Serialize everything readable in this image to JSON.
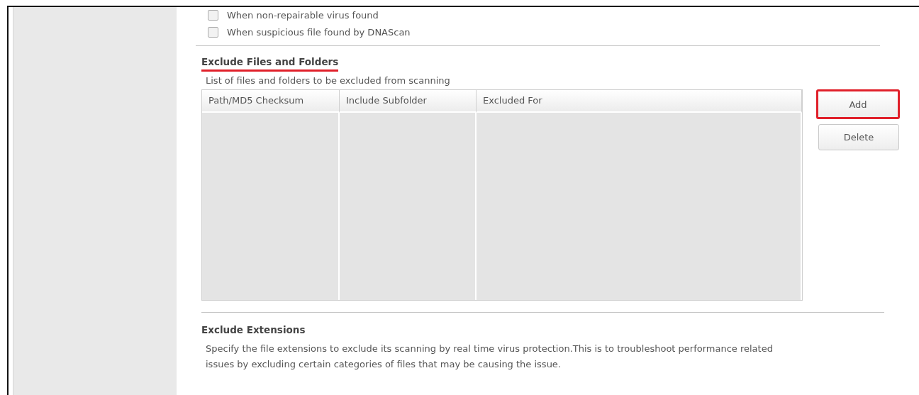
{
  "notifications": [
    {
      "label": "When non-repairable virus found",
      "checked": false
    },
    {
      "label": "When suspicious file found by DNAScan",
      "checked": false
    }
  ],
  "exclude_files": {
    "title": "Exclude Files and Folders",
    "highlighted": true,
    "description": "List of files and folders to be excluded from scanning",
    "table": {
      "columns": [
        "Path/MD5 Checksum",
        "Include Subfolder",
        "Excluded For"
      ]
    },
    "buttons": [
      {
        "label": "Add",
        "highlighted": true
      },
      {
        "label": "Delete",
        "highlighted": false
      }
    ]
  },
  "exclude_extensions": {
    "title": "Exclude Extensions",
    "description": "Specify the file extensions to exclude its scanning by real time virus protection.This is to troubleshoot performance related issues by excluding certain categories of files that may be causing the issue."
  }
}
